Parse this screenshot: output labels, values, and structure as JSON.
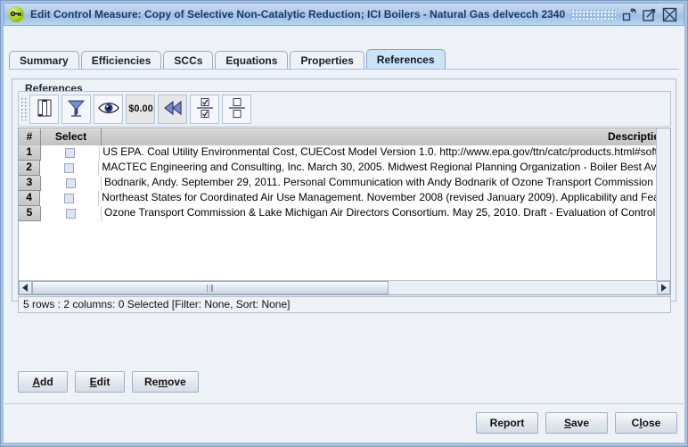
{
  "window": {
    "title": "Edit Control Measure: Copy of Selective Non-Catalytic Reduction; ICI Boilers - Natural Gas delvecch 2340",
    "icon": "key-green-icon",
    "controls": [
      {
        "name": "minimize-button",
        "glyph": "minimize"
      },
      {
        "name": "maximize-button",
        "glyph": "maximize"
      },
      {
        "name": "close-button",
        "glyph": "close"
      }
    ]
  },
  "tabs": [
    {
      "label": "Summary",
      "selected": false
    },
    {
      "label": "Efficiencies",
      "selected": false
    },
    {
      "label": "SCCs",
      "selected": false
    },
    {
      "label": "Equations",
      "selected": false
    },
    {
      "label": "Properties",
      "selected": false
    },
    {
      "label": "References",
      "selected": true
    }
  ],
  "panel": {
    "group_title": "References"
  },
  "toolbar": {
    "buttons": [
      {
        "name": "toolbar-columns-button",
        "icon": "column-settings-icon",
        "tooltip": "Columns"
      },
      {
        "name": "toolbar-filter-button",
        "icon": "funnel-filter-icon",
        "tooltip": "Filter"
      },
      {
        "name": "toolbar-show-button",
        "icon": "eye-view-icon",
        "tooltip": "Show/Hide"
      },
      {
        "name": "toolbar-format-button",
        "icon": "dollar-format-icon",
        "tooltip": "Format $0.00"
      },
      {
        "name": "toolbar-rewind-button",
        "icon": "rewind-double-arrow-icon",
        "tooltip": "Reset"
      },
      {
        "name": "toolbar-select-all-button",
        "icon": "select-all-checkboxes-icon",
        "tooltip": "Select All"
      },
      {
        "name": "toolbar-clear-selection-button",
        "icon": "clear-selection-icon",
        "tooltip": "Clear Selection"
      }
    ]
  },
  "table": {
    "columns": [
      "#",
      "Select",
      "Description"
    ],
    "rows": [
      {
        "num": "1",
        "selected": false,
        "description": "US EPA. Coal Utility Environmental Cost,  CUECost Model Version 1.0. http://www.epa.gov/ttn/catc/products.html#software"
      },
      {
        "num": "2",
        "selected": false,
        "description": "MACTEC Engineering and Consulting, Inc. March 30, 2005. Midwest Regional Planning Organization - Boiler Best Available"
      },
      {
        "num": "3",
        "selected": false,
        "description": "Bodnarik, Andy. September 29, 2011.  Personal Communication with Andy Bodnarik of Ozone Transport Commission"
      },
      {
        "num": "4",
        "selected": false,
        "description": "Northeast States for Coordinated Air Use Management. November 2008 (revised January 2009). Applicability and Feasibility"
      },
      {
        "num": "5",
        "selected": false,
        "description": "Ozone Transport Commission & Lake Michigan Air Directors Consortium. May 25, 2010. Draft - Evaluation of Control"
      }
    ],
    "status": "5 rows : 2 columns: 0 Selected [Filter: None, Sort: None]"
  },
  "crud_buttons": [
    {
      "name": "add-button",
      "label": "Add",
      "mnemonic_index": 0
    },
    {
      "name": "edit-button",
      "label": "Edit",
      "mnemonic_index": 0
    },
    {
      "name": "remove-button",
      "label": "Remove",
      "mnemonic_index": 2
    }
  ],
  "bottom_buttons": [
    {
      "name": "report-button",
      "label": "Report",
      "mnemonic_index": -1
    },
    {
      "name": "save-button",
      "label": "Save",
      "mnemonic_index": 0
    },
    {
      "name": "close-button",
      "label": "Close",
      "mnemonic_index": 1
    }
  ],
  "colors": {
    "titlebar_accent": "#9dc0e4",
    "tab_selected": "#cfe3f7",
    "panel_bg": "#eef1f6",
    "header_gray": "#c8c8c8",
    "checkbox_fill": "#dce6f2"
  }
}
